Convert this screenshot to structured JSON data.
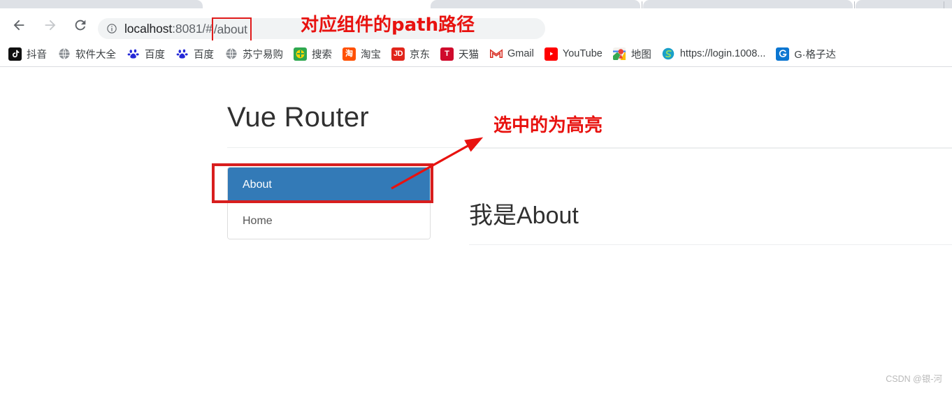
{
  "browser": {
    "nav": {
      "back_icon": "arrow-left-icon",
      "forward_icon": "arrow-right-icon",
      "reload_icon": "reload-icon"
    },
    "omnibox": {
      "info_icon": "site-info-icon",
      "url_host": "localhost",
      "url_rest": ":8081/#",
      "url_path": "/about",
      "full_url": "localhost:8081/#/about"
    },
    "bookmarks": [
      {
        "label": "抖音",
        "icon": "douyin-icon",
        "glyph": "♪"
      },
      {
        "label": "软件大全",
        "icon": "globe-icon",
        "glyph": ""
      },
      {
        "label": "百度",
        "icon": "baidu-paw-icon",
        "glyph": ""
      },
      {
        "label": "百度",
        "icon": "baidu-paw-icon",
        "glyph": ""
      },
      {
        "label": "苏宁易购",
        "icon": "globe-icon",
        "glyph": ""
      },
      {
        "label": "搜索",
        "icon": "search-plus-icon",
        "glyph": ""
      },
      {
        "label": "淘宝",
        "icon": "taobao-icon",
        "glyph": "淘"
      },
      {
        "label": "京东",
        "icon": "jd-icon",
        "glyph": "JD"
      },
      {
        "label": "天猫",
        "icon": "tmall-icon",
        "glyph": "T"
      },
      {
        "label": "Gmail",
        "icon": "gmail-icon",
        "glyph": "M"
      },
      {
        "label": "YouTube",
        "icon": "youtube-icon",
        "glyph": "▶"
      },
      {
        "label": "地图",
        "icon": "google-maps-icon",
        "glyph": ""
      },
      {
        "label": "https://login.1008...",
        "icon": "spiral-icon",
        "glyph": ""
      },
      {
        "label": "G·格子达",
        "icon": "gezida-icon",
        "glyph": "G"
      }
    ]
  },
  "page": {
    "title": "Vue Router",
    "nav_list": [
      {
        "label": "About",
        "active": true
      },
      {
        "label": "Home",
        "active": false
      }
    ],
    "content_heading": "我是About"
  },
  "annotations": {
    "path_note": "对应组件的path路径",
    "highlight_note": "选中的为高亮",
    "color": "#e8120f",
    "box_color": "#d81e1e"
  },
  "watermark": "CSDN @银-河"
}
